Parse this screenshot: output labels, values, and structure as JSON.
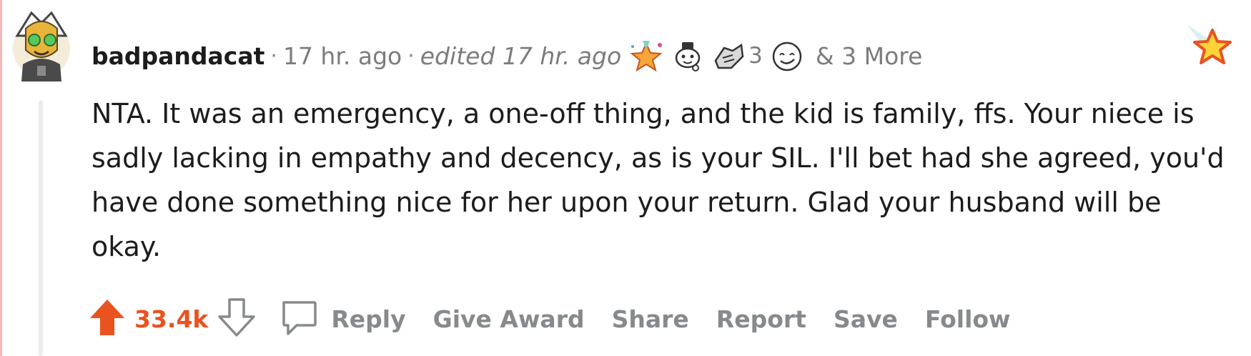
{
  "comment": {
    "username": "badpandacat",
    "time": "17 hr. ago",
    "edited": "edited 17 hr. ago",
    "separator": "·",
    "awards": [
      {
        "icon": "party-hat-star-icon"
      },
      {
        "icon": "wholesome-face-icon"
      },
      {
        "icon": "helping-hand-icon",
        "count": "3"
      },
      {
        "icon": "smiling-face-icon"
      }
    ],
    "more_awards": "& 3 More",
    "corner_icon": "star-award-icon",
    "body": "NTA. It was an emergency, a one-off thing, and the kid is family, ffs. Your niece is sadly lacking in empathy and decency, as is your SIL. I'll bet had she agreed, you'd have done something nice for her upon your return. Glad your husband will be okay."
  },
  "actions": {
    "score": "33.4k",
    "reply": "Reply",
    "give_award": "Give Award",
    "share": "Share",
    "report": "Report",
    "save": "Save",
    "follow": "Follow"
  },
  "colors": {
    "upvote": "#e8531f",
    "muted": "#878a8c",
    "text": "#1c1c1c",
    "thread_line": "#ececec"
  }
}
